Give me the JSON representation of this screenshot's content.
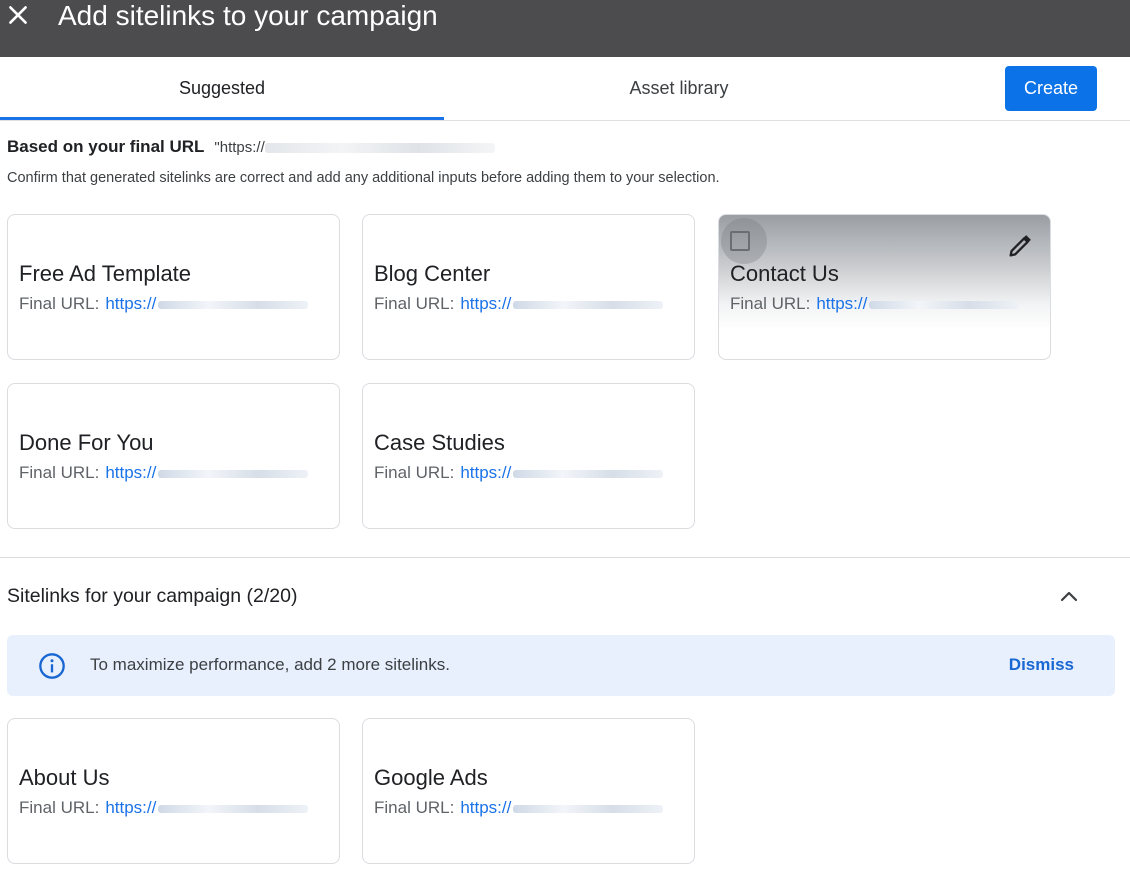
{
  "dialog": {
    "title": "Add sitelinks to your campaign",
    "close_icon": "close-icon"
  },
  "tabs": [
    {
      "label": "Suggested",
      "active": true
    },
    {
      "label": "Asset library",
      "active": false
    }
  ],
  "create_label": "Create",
  "based_on": {
    "label": "Based on your final URL",
    "url_prefix": "\"https://"
  },
  "confirm_text": "Confirm that generated sitelinks are correct and add any additional inputs before adding them to your selection.",
  "suggested": [
    {
      "title": "Free Ad Template",
      "url_label": "Final URL:",
      "url_prefix": "https://"
    },
    {
      "title": "Blog Center",
      "url_label": "Final URL:",
      "url_prefix": "https://"
    },
    {
      "title": "Contact Us",
      "url_label": "Final URL:",
      "url_prefix": "https://"
    },
    {
      "title": "Done For You",
      "url_label": "Final URL:",
      "url_prefix": "https://"
    },
    {
      "title": "Case Studies",
      "url_label": "Final URL:",
      "url_prefix": "https://"
    }
  ],
  "selected_section": {
    "title": "Sitelinks for your campaign (2/20)",
    "banner_text": "To maximize performance, add 2 more sitelinks.",
    "dismiss_label": "Dismiss",
    "items": [
      {
        "title": "About Us",
        "url_label": "Final URL:",
        "url_prefix": "https://"
      },
      {
        "title": "Google Ads",
        "url_label": "Final URL:",
        "url_prefix": "https://"
      }
    ]
  },
  "colors": {
    "accent": "#1a73e8",
    "header_bg": "#4c4c4e",
    "banner_bg": "#e8f0fe"
  }
}
